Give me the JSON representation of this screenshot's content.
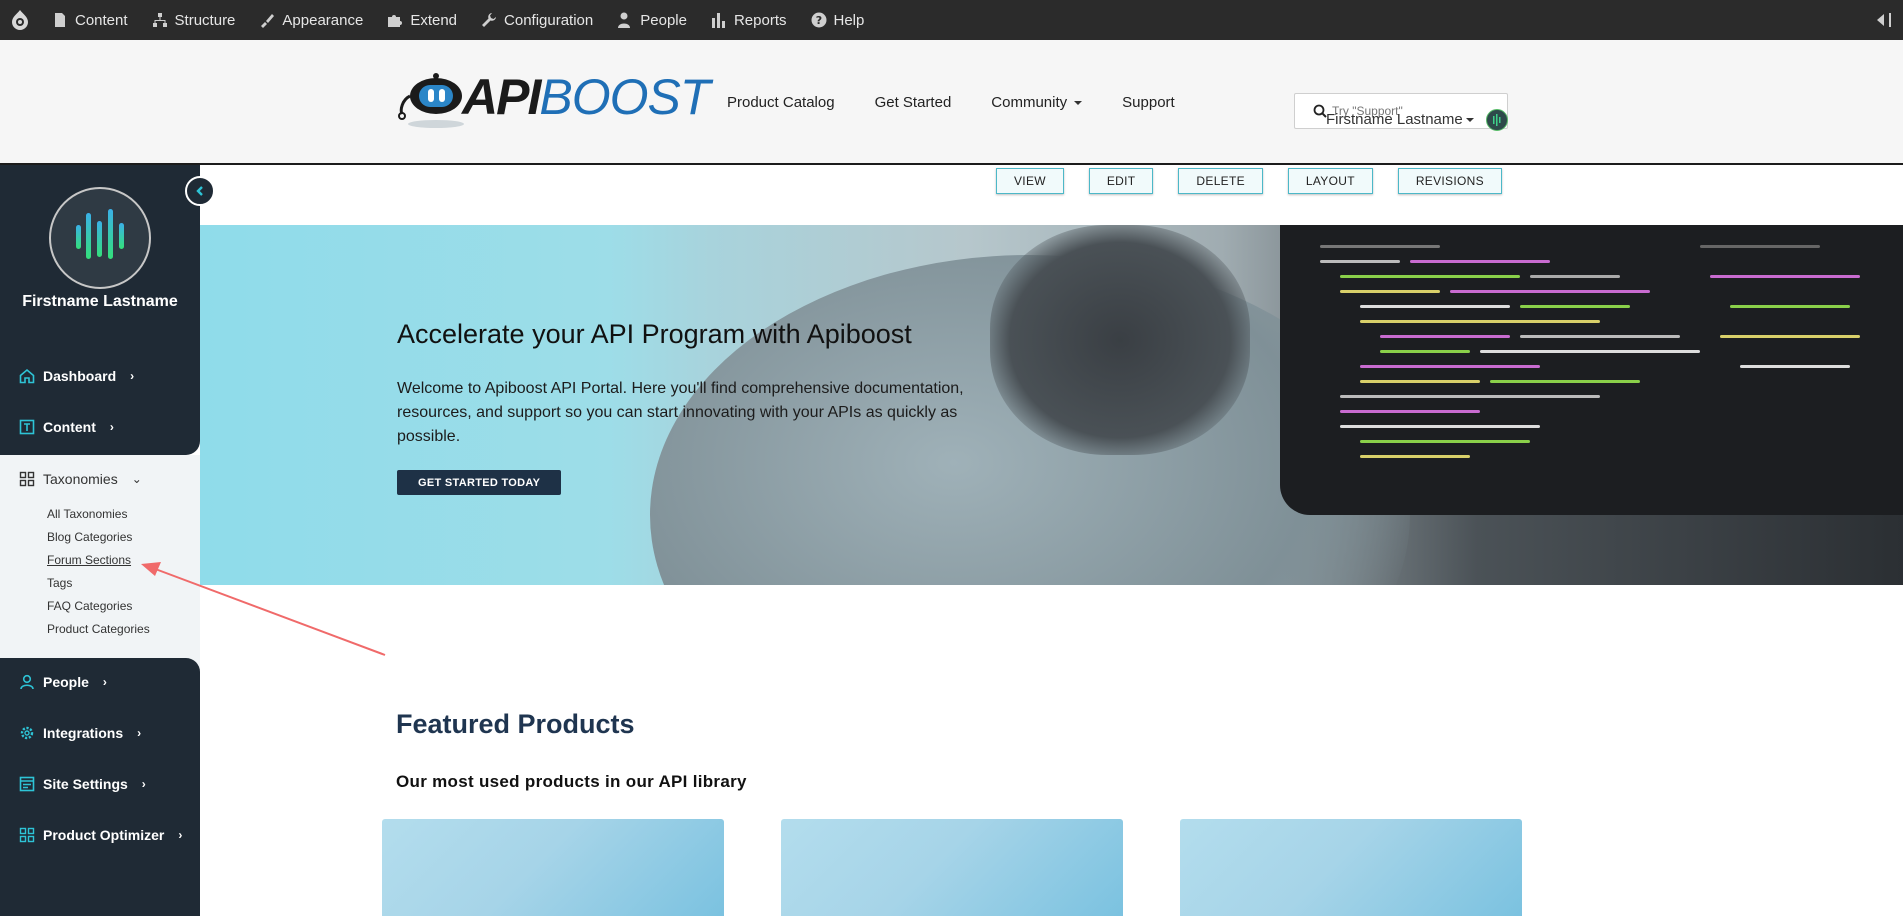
{
  "admin_toolbar": {
    "items": [
      {
        "label": "Content",
        "icon": "file-icon"
      },
      {
        "label": "Structure",
        "icon": "sitemap-icon"
      },
      {
        "label": "Appearance",
        "icon": "paintbrush-icon"
      },
      {
        "label": "Extend",
        "icon": "puzzle-icon"
      },
      {
        "label": "Configuration",
        "icon": "wrench-icon"
      },
      {
        "label": "People",
        "icon": "person-icon"
      },
      {
        "label": "Reports",
        "icon": "bar-chart-icon"
      },
      {
        "label": "Help",
        "icon": "help-icon"
      }
    ]
  },
  "header": {
    "logo_text_a": "API",
    "logo_text_b": "BOOST",
    "nav": {
      "product_catalog": "Product Catalog",
      "get_started": "Get Started",
      "community": "Community",
      "support": "Support"
    },
    "search_placeholder": "Try \"Support\"",
    "user_name": "Firstname Lastname"
  },
  "sidebar": {
    "user_name": "Firstname Lastname",
    "dashboard": "Dashboard",
    "content": "Content",
    "taxonomies": "Taxonomies",
    "taxonomy_items": {
      "all": "All Taxonomies",
      "blog": "Blog Categories",
      "forum": "Forum Sections",
      "tags": "Tags",
      "faq": "FAQ Categories",
      "product": "Product Categories"
    },
    "people": "People",
    "integrations": "Integrations",
    "site_settings": "Site Settings",
    "product_optimizer": "Product Optimizer"
  },
  "tabs": {
    "view": "VIEW",
    "edit": "EDIT",
    "delete": "DELETE",
    "layout": "LAYOUT",
    "revisions": "REVISIONS"
  },
  "hero": {
    "title": "Accelerate your API Program with Apiboost",
    "text": "Welcome to Apiboost API Portal. Here you'll find comprehensive documentation, resources, and support so you can start innovating with your APIs as quickly as possible.",
    "button": "GET STARTED TODAY"
  },
  "featured": {
    "title": "Featured Products",
    "subtitle": "Our most used products in our API library"
  },
  "colors": {
    "accent_teal": "#2ec4d6",
    "sidebar_dark": "#1f2a35",
    "brand_blue": "#1f6fb6",
    "annotation_arrow": "#f06a6a"
  }
}
